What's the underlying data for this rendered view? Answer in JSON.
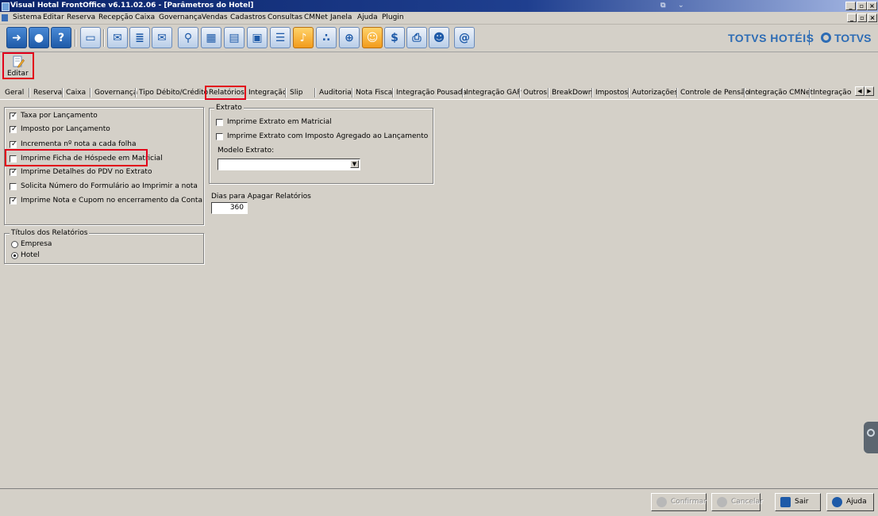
{
  "window": {
    "title": "Visual Hotal FrontOffice v6.11.02.06 - [Parâmetros do Hotel]"
  },
  "menu": [
    "Sistema",
    "Editar",
    "Reserva",
    "Recepção",
    "Caixa",
    "Governança",
    "Vendas",
    "Cadastros",
    "Consultas",
    "CMNet",
    "Janela",
    "Ajuda",
    "Plugin"
  ],
  "brand": {
    "left": "TOTVS HOTÉIS",
    "right": "TOTVS"
  },
  "edit_button": {
    "label": "Editar"
  },
  "tabs": [
    "Geral",
    "Reserva",
    "Caixa",
    "Governança",
    "Tipo Débito/Crédito",
    "Relatórios",
    "Integração",
    "Slip",
    "Auditoria",
    "Nota Fiscal",
    "Integração Pousada",
    "Integração GAP",
    "Outros",
    "BreakDown",
    "Impostos",
    "Autorizações",
    "Controle de Pensão",
    "Integração CMNet",
    "Integração Fi"
  ],
  "active_tab": "Relatórios",
  "options": [
    {
      "label": "Taxa por Lançamento",
      "checked": true
    },
    {
      "label": "Imposto por Lançamento",
      "checked": true
    },
    {
      "label": "Incrementa nº nota a cada folha",
      "checked": true
    },
    {
      "label": "Imprime Ficha de Hóspede em Matricial",
      "checked": false
    },
    {
      "label": "Imprime Detalhes do PDV no Extrato",
      "checked": true
    },
    {
      "label": "Solicita Número do Formulário ao Imprimir a nota",
      "checked": false
    },
    {
      "label": "Imprime Nota e Cupom no encerramento da Conta",
      "checked": true
    }
  ],
  "titulos": {
    "legend": "Títulos dos Relatórios",
    "options": [
      {
        "label": "Empresa",
        "selected": false
      },
      {
        "label": "Hotel",
        "selected": true
      }
    ]
  },
  "extrato": {
    "legend": "Extrato",
    "options": [
      {
        "label": "Imprime Extrato em Matricial",
        "checked": false
      },
      {
        "label": "Imprime Extrato com Imposto Agregado ao Lançamento",
        "checked": false
      }
    ],
    "modelo_label": "Modelo Extrato:",
    "modelo_value": ""
  },
  "dias": {
    "label": "Dias para Apagar Relatórios",
    "value": "360"
  },
  "footer": {
    "confirm": "Confirmar",
    "cancel": "Cancelar",
    "exit": "Sair",
    "help": "Ajuda"
  },
  "colors": {
    "highlight": "#e2001a",
    "brand": "#2d6cb5",
    "titlebar": "#0a246a"
  }
}
